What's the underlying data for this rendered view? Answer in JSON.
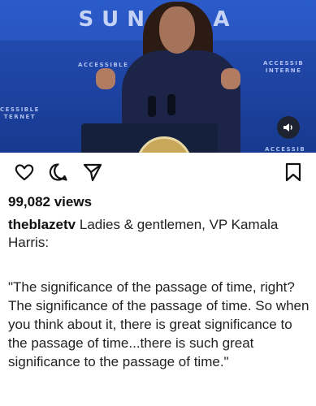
{
  "media": {
    "banner_text": "SUNS LA",
    "signs": {
      "left_top": "ACCESSIBLE\nIN",
      "right_top": "ACCESSIB\nINTERNE",
      "left_mid": "CESSIBLE\nTERNET",
      "right_bottom": "ACCESSIB"
    },
    "mute_icon": "speaker-icon"
  },
  "actions": {
    "like_icon": "heart-outline-icon",
    "comment_icon": "comment-outline-icon",
    "share_icon": "send-paper-plane-icon",
    "save_icon": "bookmark-outline-icon"
  },
  "post": {
    "views": "99,082 views",
    "username": "theblazetv",
    "caption": "Ladies & gentlemen, VP Kamala Harris:",
    "quote": "\"The significance of the passage of time, right? The significance of the passage of time. So when you think about it, there is great significance to the passage of time...there is such great significance to the passage of time.\""
  }
}
